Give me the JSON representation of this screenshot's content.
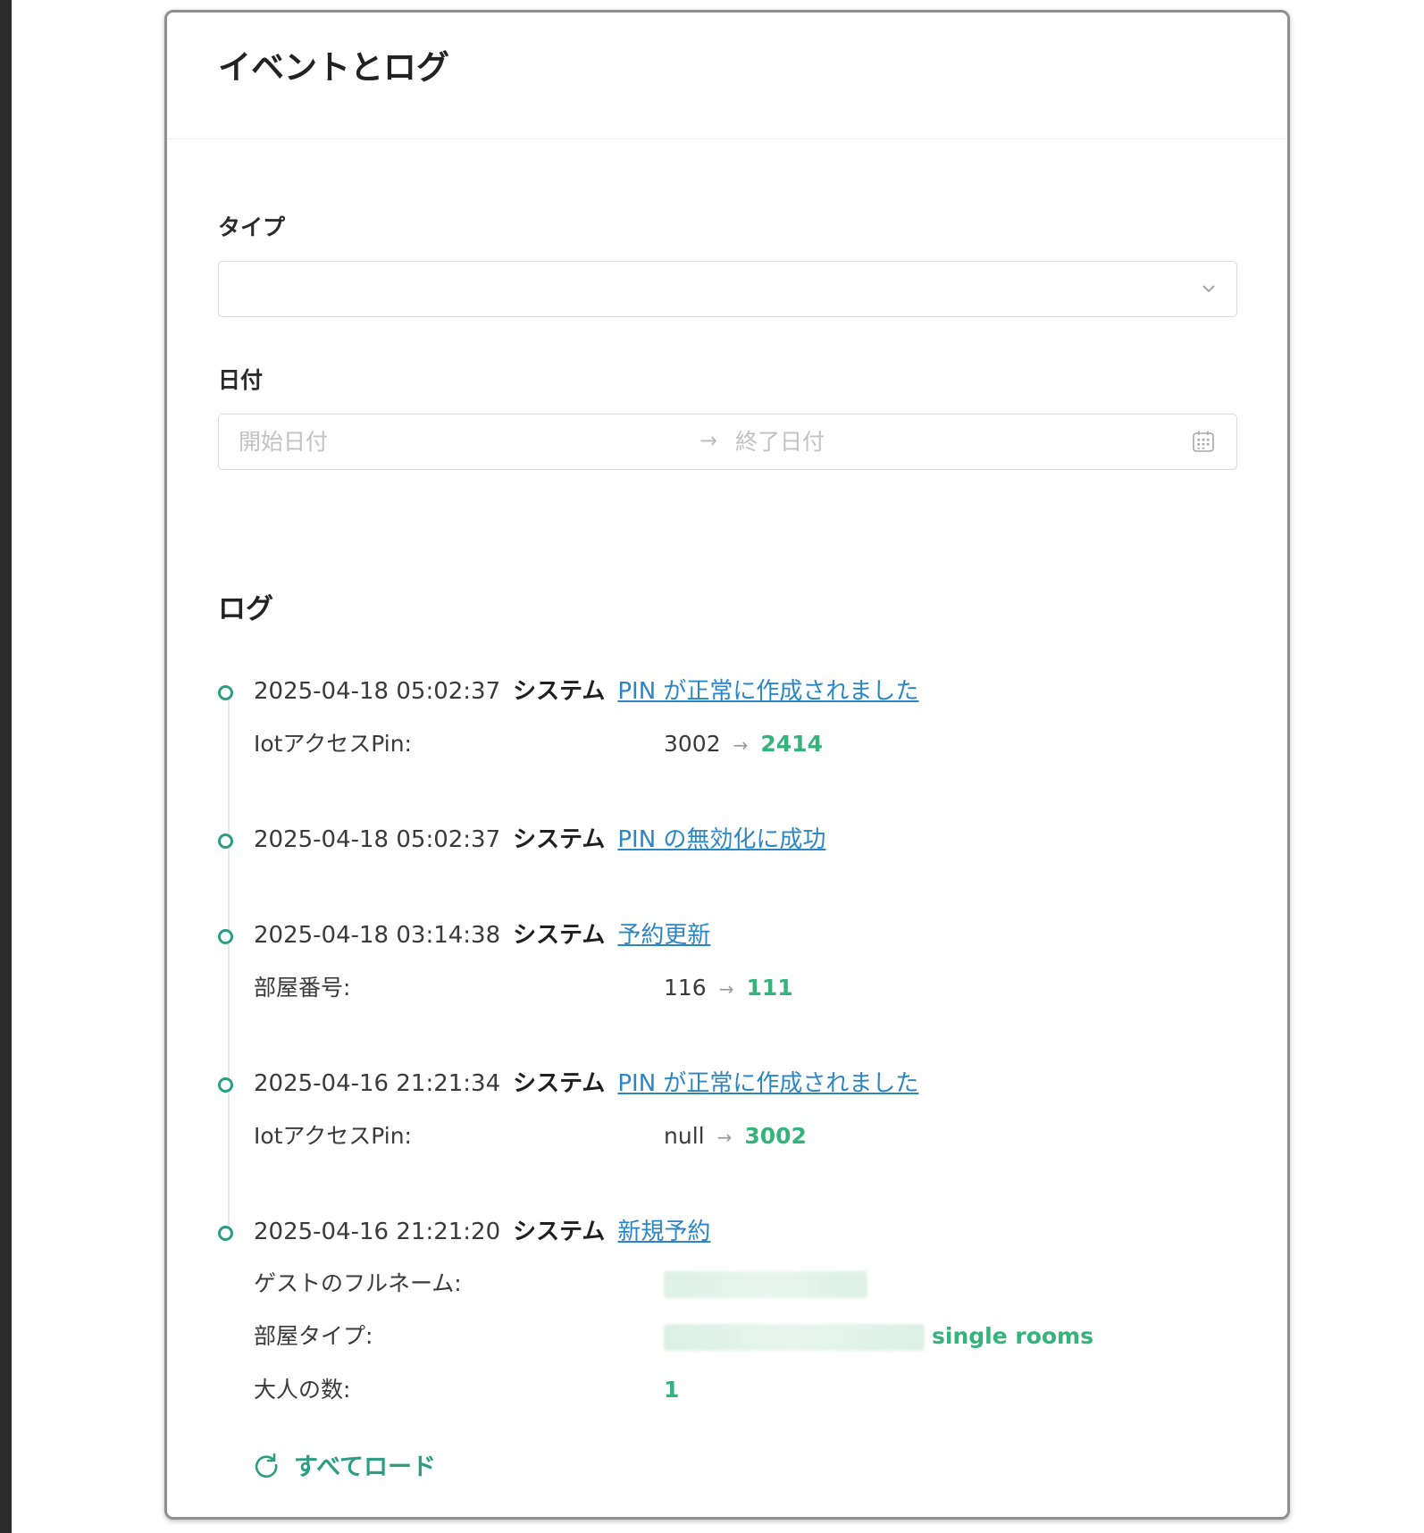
{
  "header": {
    "title": "イベントとログ"
  },
  "filters": {
    "type_label": "タイプ",
    "type_value": "",
    "date_label": "日付",
    "date_start_placeholder": "開始日付",
    "date_separator": "→",
    "date_end_placeholder": "終了日付"
  },
  "logs": {
    "title": "ログ",
    "entries": [
      {
        "timestamp": "2025-04-18 05:02:37",
        "actor": "システム",
        "event": "PIN が正常に作成されました",
        "details": [
          {
            "label": "IotアクセスPin:",
            "old": "3002",
            "arrow": "→",
            "new": "2414"
          }
        ]
      },
      {
        "timestamp": "2025-04-18 05:02:37",
        "actor": "システム",
        "event": "PIN の無効化に成功",
        "details": []
      },
      {
        "timestamp": "2025-04-18 03:14:38",
        "actor": "システム",
        "event": "予約更新",
        "details": [
          {
            "label": "部屋番号:",
            "old": "116",
            "arrow": "→",
            "new": "111"
          }
        ]
      },
      {
        "timestamp": "2025-04-16 21:21:34",
        "actor": "システム",
        "event": "PIN が正常に作成されました",
        "details": [
          {
            "label": "IotアクセスPin:",
            "old": "null",
            "arrow": "→",
            "new": "3002"
          }
        ]
      },
      {
        "timestamp": "2025-04-16 21:21:20",
        "actor": "システム",
        "event": "新規予約",
        "details": [
          {
            "label": "ゲストのフルネーム:",
            "new": ""
          },
          {
            "label": "部屋タイプ:",
            "new": "single rooms"
          },
          {
            "label": "大人の数:",
            "new": "1"
          }
        ]
      }
    ],
    "load_all_label": "すべてロード"
  },
  "colors": {
    "accent_green": "#2a9d82",
    "value_green": "#34b37a",
    "link_blue": "#2c86c6"
  },
  "icons": {
    "select": "chevron-down-icon",
    "date": "calendar-icon",
    "timeline_marker": "timeline-dot-icon",
    "load_all": "reload-icon"
  }
}
